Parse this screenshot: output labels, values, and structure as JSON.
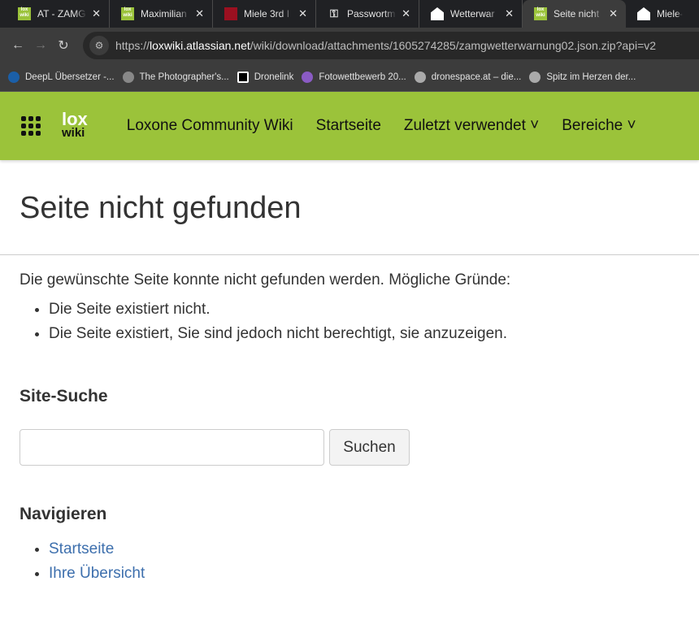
{
  "browser": {
    "tabs": [
      {
        "title": "AT - ZAMG",
        "icon": "loxwiki-icon",
        "active": false
      },
      {
        "title": "Maximilian",
        "icon": "loxwiki-icon",
        "active": false
      },
      {
        "title": "Miele 3rd I",
        "icon": "miele-icon",
        "active": false
      },
      {
        "title": "Passwortm",
        "icon": "key-icon",
        "active": false
      },
      {
        "title": "Wetterwar",
        "icon": "house-icon",
        "active": false
      },
      {
        "title": "Seite nicht",
        "icon": "loxwiki-icon",
        "active": true
      },
      {
        "title": "Miele-MQ",
        "icon": "house-icon",
        "active": false
      }
    ],
    "url_prefix": "https://",
    "url_host": "loxwiki.atlassian.net",
    "url_path": "/wiki/download/attachments/1605274285/zamgwetterwarnung02.json.zip?api=v2",
    "bookmarks": [
      {
        "label": "DeepL Übersetzer -...",
        "color": "#1b5fa8"
      },
      {
        "label": "The Photographer's...",
        "color": "#888"
      },
      {
        "label": "Dronelink",
        "color": "#000"
      },
      {
        "label": "Fotowettbewerb 20...",
        "color": "#8a5bc4"
      },
      {
        "label": "dronespace.at – die...",
        "color": "#aaa"
      },
      {
        "label": "Spitz im Herzen der...",
        "color": "#aaa"
      }
    ]
  },
  "header": {
    "logo_top": "lox",
    "logo_bottom": "wiki",
    "nav": [
      "Loxone Community Wiki",
      "Startseite",
      "Zuletzt verwendet ˅",
      "Bereiche ˅"
    ],
    "color": "#9bc33a"
  },
  "page": {
    "title": "Seite nicht gefunden",
    "intro": "Die gewünschte Seite konnte nicht gefunden werden. Mögliche Gründe:",
    "reasons": [
      "Die Seite existiert nicht.",
      "Die Seite existiert, Sie sind jedoch nicht berechtigt, sie anzuzeigen."
    ],
    "search_heading": "Site-Suche",
    "search_value": "",
    "search_button": "Suchen",
    "nav_heading": "Navigieren",
    "nav_links": [
      "Startseite",
      "Ihre Übersicht"
    ]
  }
}
